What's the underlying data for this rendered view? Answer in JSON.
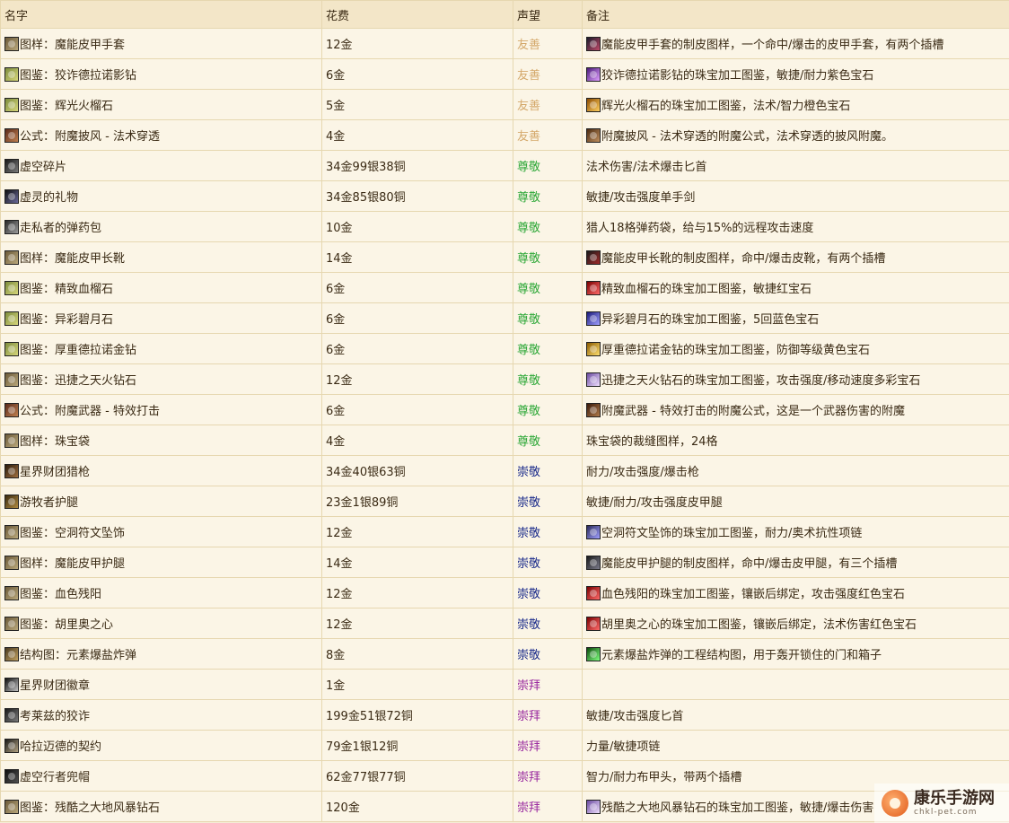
{
  "headers": {
    "name": "名字",
    "cost": "花费",
    "rep": "声望",
    "note": "备注"
  },
  "rows": [
    {
      "icon": "i-pattern",
      "name": "图样：魔能皮甲手套",
      "cost": "12金",
      "rep": "友善",
      "repClass": "rep-friendly",
      "noteIcon": "i-gloves",
      "note": "魔能皮甲手套的制皮图样，一个命中/爆击的皮甲手套，有两个插槽"
    },
    {
      "icon": "i-design",
      "name": "图鉴：狡诈德拉诺影钻",
      "cost": "6金",
      "rep": "友善",
      "repClass": "rep-friendly",
      "noteIcon": "i-gem-purple",
      "note": "狡诈德拉诺影钻的珠宝加工图鉴，敏捷/耐力紫色宝石"
    },
    {
      "icon": "i-design",
      "name": "图鉴：辉光火榴石",
      "cost": "5金",
      "rep": "友善",
      "repClass": "rep-friendly",
      "noteIcon": "i-gem-orange",
      "note": "辉光火榴石的珠宝加工图鉴，法术/智力橙色宝石"
    },
    {
      "icon": "i-formula",
      "name": "公式：附魔披风 - 法术穿透",
      "cost": "4金",
      "rep": "友善",
      "repClass": "rep-friendly",
      "noteIcon": "i-cloak",
      "note": "附魔披风 - 法术穿透的附魔公式，法术穿透的披风附魔。"
    },
    {
      "icon": "i-dagger",
      "name": "虚空碎片",
      "cost": "34金99银38铜",
      "rep": "尊敬",
      "repClass": "rep-honored",
      "noteIcon": "",
      "note": "法术伤害/法术爆击匕首"
    },
    {
      "icon": "i-sword",
      "name": "虚灵的礼物",
      "cost": "34金85银80铜",
      "rep": "尊敬",
      "repClass": "rep-honored",
      "noteIcon": "",
      "note": "敏捷/攻击强度单手剑"
    },
    {
      "icon": "i-bag",
      "name": "走私者的弹药包",
      "cost": "10金",
      "rep": "尊敬",
      "repClass": "rep-honored",
      "noteIcon": "",
      "note": "猎人18格弹药袋，给与15%的远程攻击速度"
    },
    {
      "icon": "i-pattern",
      "name": "图样：魔能皮甲长靴",
      "cost": "14金",
      "rep": "尊敬",
      "repClass": "rep-honored",
      "noteIcon": "i-boots",
      "note": "魔能皮甲长靴的制皮图样，命中/爆击皮靴，有两个插槽"
    },
    {
      "icon": "i-design",
      "name": "图鉴：精致血榴石",
      "cost": "6金",
      "rep": "尊敬",
      "repClass": "rep-honored",
      "noteIcon": "i-gem-red",
      "note": "精致血榴石的珠宝加工图鉴，敏捷红宝石"
    },
    {
      "icon": "i-design",
      "name": "图鉴：异彩碧月石",
      "cost": "6金",
      "rep": "尊敬",
      "repClass": "rep-honored",
      "noteIcon": "i-gem-blue",
      "note": "异彩碧月石的珠宝加工图鉴，5回蓝色宝石"
    },
    {
      "icon": "i-design",
      "name": "图鉴：厚重德拉诺金钻",
      "cost": "6金",
      "rep": "尊敬",
      "repClass": "rep-honored",
      "noteIcon": "i-gem-yellow",
      "note": "厚重德拉诺金钻的珠宝加工图鉴，防御等级黄色宝石"
    },
    {
      "icon": "i-pattern",
      "name": "图鉴：迅捷之天火钻石",
      "cost": "12金",
      "rep": "尊敬",
      "repClass": "rep-honored",
      "noteIcon": "i-gem-multi",
      "note": "迅捷之天火钻石的珠宝加工图鉴，攻击强度/移动速度多彩宝石"
    },
    {
      "icon": "i-formula",
      "name": "公式：附魔武器 - 特效打击",
      "cost": "6金",
      "rep": "尊敬",
      "repClass": "rep-honored",
      "noteIcon": "i-weapon",
      "note": "附魔武器 - 特效打击的附魔公式，这是一个武器伤害的附魔"
    },
    {
      "icon": "i-pattern",
      "name": "图样：珠宝袋",
      "cost": "4金",
      "rep": "尊敬",
      "repClass": "rep-honored",
      "noteIcon": "",
      "note": "珠宝袋的裁缝图样，24格"
    },
    {
      "icon": "i-gun",
      "name": "星界财团猎枪",
      "cost": "34金40银63铜",
      "rep": "崇敬",
      "repClass": "rep-revered",
      "noteIcon": "",
      "note": "耐力/攻击强度/爆击枪"
    },
    {
      "icon": "i-legs",
      "name": "游牧者护腿",
      "cost": "23金1银89铜",
      "rep": "崇敬",
      "repClass": "rep-revered",
      "noteIcon": "",
      "note": "敏捷/耐力/攻击强度皮甲腿"
    },
    {
      "icon": "i-pattern",
      "name": "图鉴：空洞符文坠饰",
      "cost": "12金",
      "rep": "崇敬",
      "repClass": "rep-revered",
      "noteIcon": "i-neck2",
      "note": "空洞符文坠饰的珠宝加工图鉴，耐力/奥术抗性项链"
    },
    {
      "icon": "i-pattern",
      "name": "图样：魔能皮甲护腿",
      "cost": "14金",
      "rep": "崇敬",
      "repClass": "rep-revered",
      "noteIcon": "i-legs2",
      "note": "魔能皮甲护腿的制皮图样，命中/爆击皮甲腿，有三个插槽"
    },
    {
      "icon": "i-pattern",
      "name": "图鉴：血色残阳",
      "cost": "12金",
      "rep": "崇敬",
      "repClass": "rep-revered",
      "noteIcon": "i-gem-red",
      "note": "血色残阳的珠宝加工图鉴，镶嵌后绑定，攻击强度红色宝石"
    },
    {
      "icon": "i-pattern",
      "name": "图鉴：胡里奥之心",
      "cost": "12金",
      "rep": "崇敬",
      "repClass": "rep-revered",
      "noteIcon": "i-gem-red",
      "note": "胡里奥之心的珠宝加工图鉴，镶嵌后绑定，法术伤害红色宝石"
    },
    {
      "icon": "i-schem",
      "name": "结构图：元素爆盐炸弹",
      "cost": "8金",
      "rep": "崇敬",
      "repClass": "rep-revered",
      "noteIcon": "i-bomb",
      "note": "元素爆盐炸弹的工程结构图，用于轰开锁住的门和箱子"
    },
    {
      "icon": "i-badge",
      "name": "星界财团徽章",
      "cost": "1金",
      "rep": "崇拜",
      "repClass": "rep-exalted",
      "noteIcon": "",
      "note": ""
    },
    {
      "icon": "i-dagger",
      "name": "考莱兹的狡诈",
      "cost": "199金51银72铜",
      "rep": "崇拜",
      "repClass": "rep-exalted",
      "noteIcon": "",
      "note": "敏捷/攻击强度匕首"
    },
    {
      "icon": "i-neck",
      "name": "哈拉迈德的契约",
      "cost": "79金1银12铜",
      "rep": "崇拜",
      "repClass": "rep-exalted",
      "noteIcon": "",
      "note": "力量/敏捷项链"
    },
    {
      "icon": "i-hood",
      "name": "虚空行者兜帽",
      "cost": "62金77银77铜",
      "rep": "崇拜",
      "repClass": "rep-exalted",
      "noteIcon": "",
      "note": "智力/耐力布甲头，带两个插槽"
    },
    {
      "icon": "i-pattern",
      "name": "图鉴：残酷之大地风暴钻石",
      "cost": "120金",
      "rep": "崇拜",
      "repClass": "rep-exalted",
      "noteIcon": "i-gem-multi",
      "note": "残酷之大地风暴钻石的珠宝加工图鉴，敏捷/爆击伤害"
    }
  ],
  "watermark": {
    "title": "康乐手游网",
    "url": "chkl-pet.com"
  }
}
